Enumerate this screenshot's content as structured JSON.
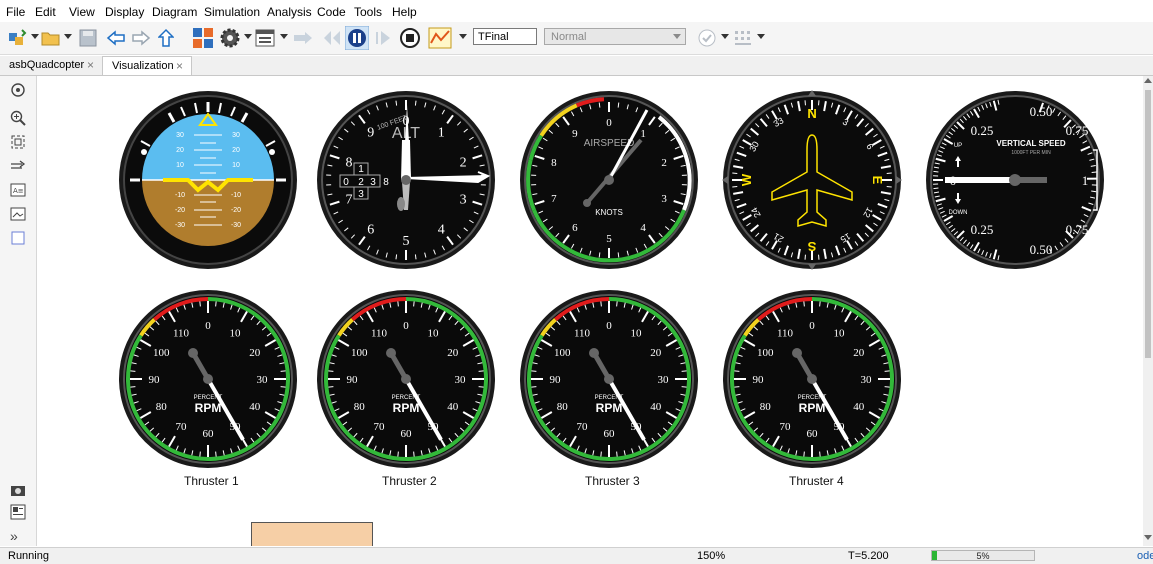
{
  "menu": [
    "File",
    "Edit",
    "View",
    "Display",
    "Diagram",
    "Simulation",
    "Analysis",
    "Code",
    "Tools",
    "Help"
  ],
  "toolbar": {
    "stop_time_value": "TFinal",
    "simulation_mode": "Normal",
    "icons": [
      "library-browser-icon",
      "open-icon",
      "save-icon",
      "back-icon",
      "forward-icon",
      "up-icon",
      "model-explorer-icon",
      "settings-gear-icon",
      "model-config-icon",
      "step-back-icon",
      "pause-icon",
      "step-forward-icon",
      "stop-icon",
      "data-inspector-icon",
      "check-icon",
      "grid-icon"
    ]
  },
  "tabs": [
    {
      "label": "asbQuadcopter",
      "active": false
    },
    {
      "label": "Visualization",
      "active": true
    }
  ],
  "gauges": {
    "attitude": {
      "left_labels": [
        "30",
        "20",
        "10",
        "-10",
        "-20",
        "-30"
      ],
      "right_labels": [
        "30",
        "20",
        "10",
        "-10",
        "-20",
        "-30"
      ]
    },
    "altimeter": {
      "numerals": [
        "0",
        "1",
        "2",
        "3",
        "4",
        "5",
        "6",
        "7",
        "8",
        "9"
      ],
      "caption": "100 FEET",
      "title": "ALT",
      "drum": [
        "1",
        "0",
        "2",
        "3",
        "8",
        "3"
      ]
    },
    "airspeed": {
      "numerals": [
        "0",
        "1",
        "2",
        "3",
        "4",
        "5",
        "6",
        "7",
        "8",
        "9"
      ],
      "title": "AIRSPEED",
      "unit": "KNOTS"
    },
    "heading": {
      "letters": [
        "N",
        "E",
        "S",
        "W"
      ],
      "numbers": [
        "3",
        "6",
        "12",
        "15",
        "21",
        "24",
        "30",
        "33"
      ]
    },
    "vertical_speed": {
      "title": "VERTICAL SPEED",
      "subtitle": "1000FT PER MIN",
      "up": "UP",
      "down": "DOWN",
      "labels": [
        "0.50",
        "0.25",
        "0.75",
        "0",
        "1",
        "0.25",
        "0.75",
        "0.50"
      ]
    },
    "rpm": {
      "ticks": [
        "0",
        "10",
        "20",
        "30",
        "40",
        "50",
        "60",
        "70",
        "80",
        "90",
        "100",
        "110"
      ],
      "caption": "PERCENT",
      "unit": "RPM"
    }
  },
  "thrusters": [
    {
      "label": "Thruster 1",
      "rpm_percent": 50
    },
    {
      "label": "Thruster 2",
      "rpm_percent": 50
    },
    {
      "label": "Thruster 3",
      "rpm_percent": 50
    },
    {
      "label": "Thruster 4",
      "rpm_percent": 50
    }
  ],
  "colors": {
    "sky": "#5bbdf0",
    "ground": "#b07d2d",
    "horizon": "#ffe400",
    "gauge_face": "#0a0a0a",
    "green_arc": "#33b93a",
    "red_arc": "#e11c1c",
    "yellow_arc": "#f2d21e"
  },
  "status": {
    "state": "Running",
    "zoom": "150%",
    "time": "T=5.200",
    "progress": 0.05,
    "progress_label": "5%",
    "solver": "ode"
  }
}
